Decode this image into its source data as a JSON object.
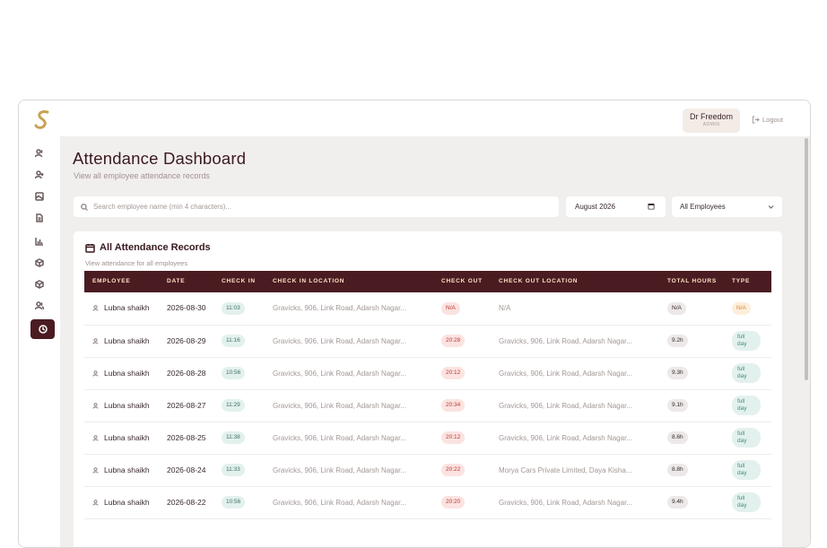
{
  "user": {
    "name": "Dr Freedom",
    "role": "ADMIN"
  },
  "logout_label": "Logout",
  "page": {
    "title": "Attendance Dashboard",
    "subtitle": "View all employee attendance records"
  },
  "search": {
    "placeholder": "Search employee name (min 4 characters)..."
  },
  "month_filter": {
    "value": "August 2026"
  },
  "employee_filter": {
    "value": "All Employees"
  },
  "card": {
    "title": "All Attendance Records",
    "subtitle": "View attendance for all employees"
  },
  "table": {
    "headers": [
      "EMPLOYEE",
      "DATE",
      "CHECK IN",
      "CHECK IN LOCATION",
      "CHECK OUT",
      "CHECK OUT LOCATION",
      "TOTAL HOURS",
      "TYPE"
    ],
    "rows": [
      {
        "employee": "Lubna shaikh",
        "date": "2026-08-30",
        "check_in": "11:03",
        "check_in_location": "Gravicks, 906, Link Road, Adarsh Nagar...",
        "check_out": "N/A",
        "check_out_location": "N/A",
        "total_hours": "N/A",
        "type": "N/A"
      },
      {
        "employee": "Lubna shaikh",
        "date": "2026-08-29",
        "check_in": "11:16",
        "check_in_location": "Gravicks, 906, Link Road, Adarsh Nagar...",
        "check_out": "20:28",
        "check_out_location": "Gravicks, 906, Link Road, Adarsh Nagar...",
        "total_hours": "9.2h",
        "type": "full day"
      },
      {
        "employee": "Lubna shaikh",
        "date": "2026-08-28",
        "check_in": "10:56",
        "check_in_location": "Gravicks, 906, Link Road, Adarsh Nagar...",
        "check_out": "20:12",
        "check_out_location": "Gravicks, 906, Link Road, Adarsh Nagar...",
        "total_hours": "9.3h",
        "type": "full day"
      },
      {
        "employee": "Lubna shaikh",
        "date": "2026-08-27",
        "check_in": "11:29",
        "check_in_location": "Gravicks, 906, Link Road, Adarsh Nagar...",
        "check_out": "20:34",
        "check_out_location": "Gravicks, 906, Link Road, Adarsh Nagar...",
        "total_hours": "9.1h",
        "type": "full day"
      },
      {
        "employee": "Lubna shaikh",
        "date": "2026-08-25",
        "check_in": "11:38",
        "check_in_location": "Gravicks, 906, Link Road, Adarsh Nagar...",
        "check_out": "20:12",
        "check_out_location": "Gravicks, 906, Link Road, Adarsh Nagar...",
        "total_hours": "8.6h",
        "type": "full day"
      },
      {
        "employee": "Lubna shaikh",
        "date": "2026-08-24",
        "check_in": "11:33",
        "check_in_location": "Gravicks, 906, Link Road, Adarsh Nagar...",
        "check_out": "20:22",
        "check_out_location": "Morya Cars Private Limited, Daya Kisha...",
        "total_hours": "8.8h",
        "type": "full day"
      },
      {
        "employee": "Lubna shaikh",
        "date": "2026-08-22",
        "check_in": "10:56",
        "check_in_location": "Gravicks, 906, Link Road, Adarsh Nagar...",
        "check_out": "20:20",
        "check_out_location": "Gravicks, 906, Link Road, Adarsh Nagar...",
        "total_hours": "9.4h",
        "type": "full day"
      }
    ]
  },
  "sidebar": {
    "items": [
      "users-icon",
      "user-plus-icon",
      "image-icon",
      "document-icon",
      "bar-chart-icon",
      "box-icon",
      "package-icon",
      "team-icon",
      "clock-icon"
    ],
    "active": "clock-icon"
  },
  "colors": {
    "brand": "#4a1c22",
    "header_text": "#ffe2c4",
    "background": "#f1efed"
  }
}
